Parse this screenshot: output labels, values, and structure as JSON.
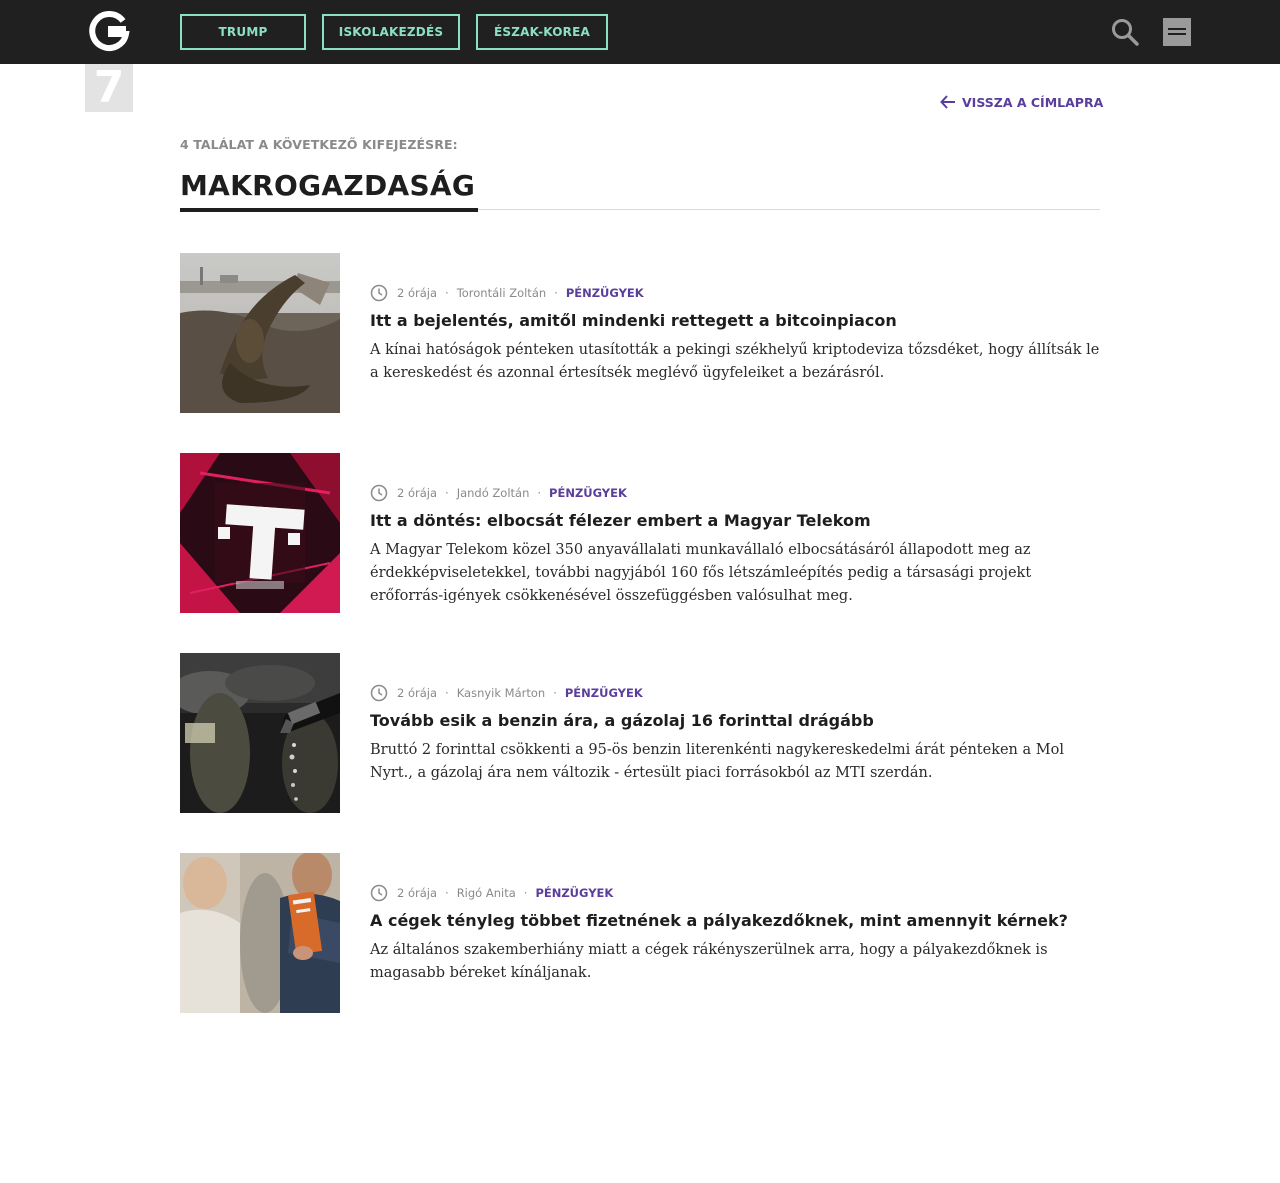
{
  "header": {
    "logo_letter": "G",
    "logo_number": "7",
    "tags": [
      "TRUMP",
      "ISKOLAKEZDÉS",
      "ÉSZAK-KOREA"
    ],
    "search_icon": "search-icon",
    "menu_icon": "hamburger-menu-icon"
  },
  "colors": {
    "topbar": "#202020",
    "tag_accent": "#8be0c4",
    "link_accent": "#5b3d9b"
  },
  "back_link": "VISSZA A CÍMLAPRA",
  "results": {
    "count_label": "4 TALÁLAT A KÖVETKEZŐ KIFEJEZÉSRE:",
    "term": "MAKROGAZDASÁG"
  },
  "articles": [
    {
      "time": "2 órája",
      "author": "Torontáli Zoltán",
      "category": "PÉNZÜGYEK",
      "title": "Itt a bejelentés, amitől mindenki rettegett a bitcoinpiacon",
      "lead": "A kínai hatóságok pénteken utasították a pekingi székhelyű kriptodeviza tőzsdéket, hogy állítsák le a kereskedést és azonnal értesítsék meglévő ügyfeleiket a bezárásról."
    },
    {
      "time": "2 órája",
      "author": "Jandó Zoltán",
      "category": "PÉNZÜGYEK",
      "title": "Itt a döntés: elbocsát félezer embert a Magyar Telekom",
      "lead": "A Magyar Telekom közel 350 anyavállalati munkavállaló elbocsátásáról állapodott meg az érdekképviseletekkel, további nagyjából 160 fős létszámleépítés pedig a társasági projekt erőforrás-igények csökkenésével összefüggésben valósulhat meg."
    },
    {
      "time": "2 órája",
      "author": "Kasnyik Márton",
      "category": "PÉNZÜGYEK",
      "title": "Tovább esik a benzin ára, a gázolaj 16 forinttal drágább",
      "lead": "Bruttó 2 forinttal csökkenti a 95-ös benzin literenkénti nagykereskedelmi árát pénteken a Mol Nyrt., a gázolaj ára nem változik - értesült piaci forrásokból az MTI szerdán."
    },
    {
      "time": "2 órája",
      "author": "Rigó Anita",
      "category": "PÉNZÜGYEK",
      "title": "A cégek tényleg többet fizetnének a pályakezdőknek, mint amennyit kérnek?",
      "lead": "Az általános szakemberhiány miatt a cégek rákényszerülnek arra, hogy a pályakezdőknek is magasabb béreket kínáljanak."
    }
  ]
}
